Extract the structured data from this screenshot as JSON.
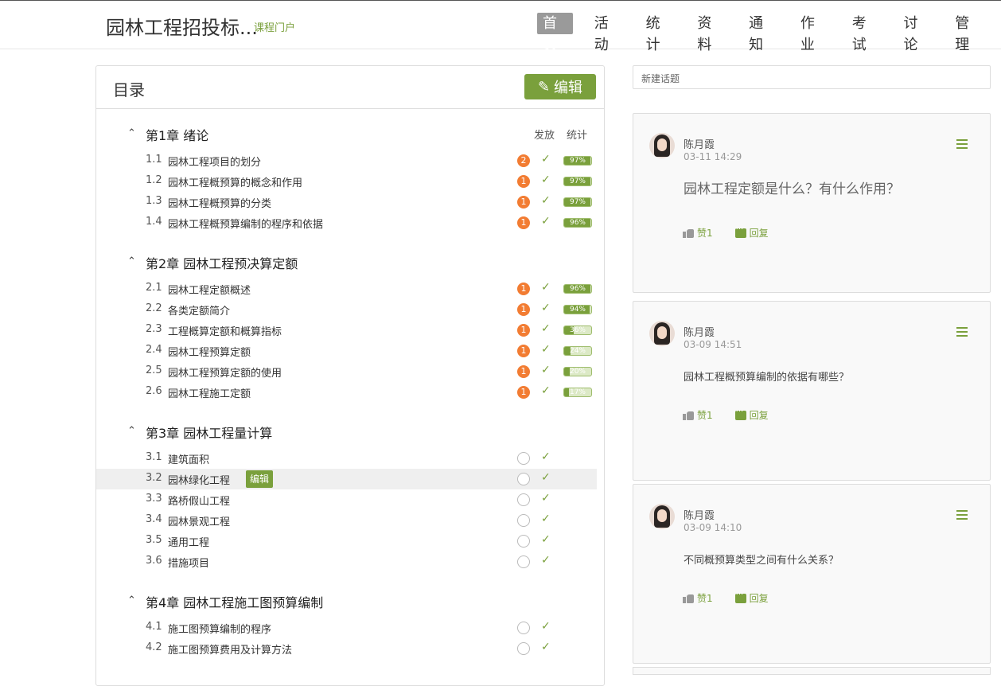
{
  "header": {
    "course_title": "园林工程招投标...",
    "portal_link": "课程门户",
    "nav": [
      "首页",
      "活动",
      "统计",
      "资料",
      "通知",
      "作业",
      "考试",
      "讨论",
      "管理"
    ]
  },
  "toc": {
    "title": "目录",
    "edit_label": "编辑",
    "col_publish": "发放",
    "col_stats": "统计",
    "chapters": [
      {
        "name": "第1章 绪论",
        "sections": [
          {
            "num": "1.1",
            "name": "园林工程项目的划分",
            "badge": "2",
            "pct": "97%"
          },
          {
            "num": "1.2",
            "name": "园林工程概预算的概念和作用",
            "badge": "1",
            "pct": "97%"
          },
          {
            "num": "1.3",
            "name": "园林工程概预算的分类",
            "badge": "1",
            "pct": "97%"
          },
          {
            "num": "1.4",
            "name": "园林工程概预算编制的程序和依据",
            "badge": "1",
            "pct": "96%"
          }
        ]
      },
      {
        "name": "第2章 园林工程预决算定额",
        "sections": [
          {
            "num": "2.1",
            "name": "园林工程定额概述",
            "badge": "1",
            "pct": "96%"
          },
          {
            "num": "2.2",
            "name": "各类定额简介",
            "badge": "1",
            "pct": "94%"
          },
          {
            "num": "2.3",
            "name": "工程概算定额和概算指标",
            "badge": "1",
            "pct": "36%"
          },
          {
            "num": "2.4",
            "name": "园林工程预算定额",
            "badge": "1",
            "pct": "24%"
          },
          {
            "num": "2.5",
            "name": "园林工程预算定额的使用",
            "badge": "1",
            "pct": "20%"
          },
          {
            "num": "2.6",
            "name": "园林工程施工定额",
            "badge": "1",
            "pct": "17%"
          }
        ]
      },
      {
        "name": "第3章 园林工程量计算",
        "sections": [
          {
            "num": "3.1",
            "name": "建筑面积"
          },
          {
            "num": "3.2",
            "name": "园林绿化工程",
            "edit": "编辑"
          },
          {
            "num": "3.3",
            "name": "路桥假山工程"
          },
          {
            "num": "3.4",
            "name": "园林景观工程"
          },
          {
            "num": "3.5",
            "name": "通用工程"
          },
          {
            "num": "3.6",
            "name": "措施项目"
          }
        ]
      },
      {
        "name": "第4章 园林工程施工图预算编制",
        "sections": [
          {
            "num": "4.1",
            "name": "施工图预算编制的程序"
          },
          {
            "num": "4.2",
            "name": "施工图预算费用及计算方法"
          }
        ]
      }
    ]
  },
  "discussion": {
    "new_topic_placeholder": "新建话题",
    "like_label": "赞1",
    "reply_label": "回复",
    "posts": [
      {
        "author": "陈月霞",
        "time": "03-11 14:29",
        "content": "园林工程定额是什么？有什么作用？"
      },
      {
        "author": "陈月霞",
        "time": "03-09 14:51",
        "content": "园林工程概预算编制的依据有哪些？"
      },
      {
        "author": "陈月霞",
        "time": "03-09 14:10",
        "content": "不同概预算类型之间有什么关系？"
      }
    ]
  },
  "colors": {
    "accent": "#7aa03c",
    "badge": "#f27c32"
  }
}
